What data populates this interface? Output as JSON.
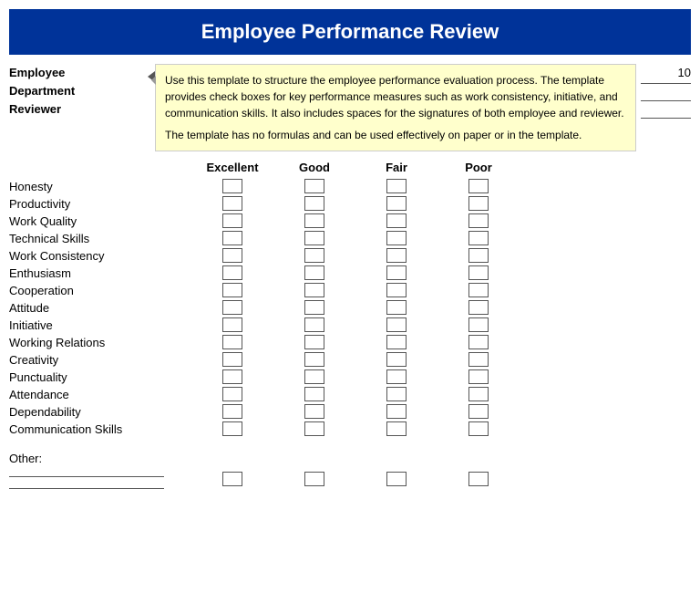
{
  "title": "Employee Performance Review",
  "tooltip": {
    "para1": "Use this template to structure the employee performance evaluation process. The template provides check boxes for key performance measures such as work consistency, initiative, and communication skills. It also includes spaces for the signatures of both employee and reviewer.",
    "para2": "The template has no formulas and can be used effectively on paper or in the template."
  },
  "fields": {
    "employee_label": "Employee",
    "department_label": "Department",
    "reviewer_label": "Reviewer",
    "year": "10"
  },
  "ratings_header": {
    "blank": "",
    "excellent": "Excellent",
    "good": "Good",
    "fair": "Fair",
    "poor": "Poor"
  },
  "skills": [
    "Honesty",
    "Productivity",
    "Work Quality",
    "Technical Skills",
    "Work Consistency",
    "Enthusiasm",
    "Cooperation",
    "Attitude",
    "Initiative",
    "Working Relations",
    "Creativity",
    "Punctuality",
    "Attendance",
    "Dependability",
    "Communication Skills"
  ],
  "other_label": "Other:"
}
